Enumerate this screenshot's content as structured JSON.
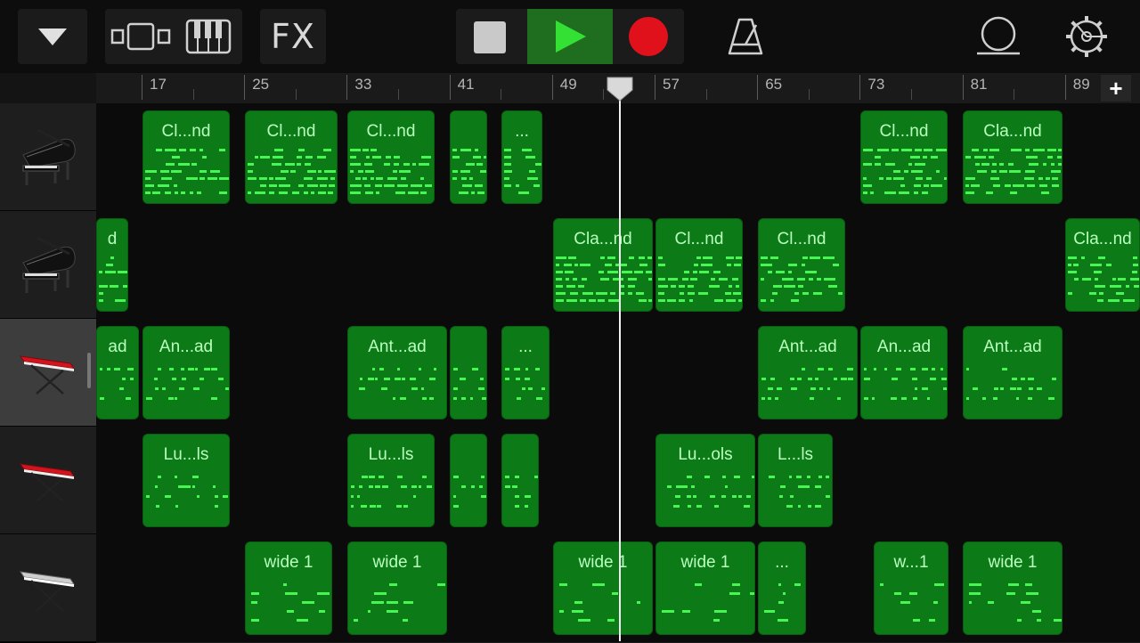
{
  "toolbar": {
    "fx_label": "FX",
    "icons": [
      "dropdown-triangle-icon",
      "view-toggle-icon",
      "keyboard-icon",
      "stop-icon",
      "play-icon",
      "record-icon",
      "metronome-icon",
      "loop-icon",
      "settings-gear-icon"
    ],
    "play_color": "#1f6e1f",
    "record_color": "#e0111a"
  },
  "ruler": {
    "bars": [
      "17",
      "25",
      "33",
      "41",
      "49",
      "57",
      "65",
      "73",
      "81",
      "89"
    ],
    "add_label": "+"
  },
  "tracks": [
    {
      "instrument": "grand-piano",
      "selected": false,
      "regions": [
        {
          "label": "Cl...nd"
        },
        {
          "label": "Cl...nd"
        },
        {
          "label": "Cl...nd"
        },
        {
          "label": ""
        },
        {
          "label": "..."
        },
        {
          "label": "Cl...nd"
        },
        {
          "label": "Cla...nd"
        }
      ]
    },
    {
      "instrument": "grand-piano",
      "selected": false,
      "regions": [
        {
          "label": "d"
        },
        {
          "label": "Cla...nd"
        },
        {
          "label": "Cl...nd"
        },
        {
          "label": "Cl...nd"
        },
        {
          "label": "Cla...nd"
        }
      ]
    },
    {
      "instrument": "red-keyboard",
      "selected": true,
      "regions": [
        {
          "label": "ad"
        },
        {
          "label": "An...ad"
        },
        {
          "label": "Ant...ad"
        },
        {
          "label": ""
        },
        {
          "label": "..."
        },
        {
          "label": "Ant...ad"
        },
        {
          "label": "An...ad"
        },
        {
          "label": "Ant...ad"
        }
      ]
    },
    {
      "instrument": "red-keyboard",
      "selected": false,
      "regions": [
        {
          "label": "Lu...ls"
        },
        {
          "label": "Lu...ls"
        },
        {
          "label": ""
        },
        {
          "label": ""
        },
        {
          "label": "Lu...ols"
        },
        {
          "label": "L...ls"
        }
      ]
    },
    {
      "instrument": "synth-keyboard",
      "selected": false,
      "regions": [
        {
          "label": "wide 1"
        },
        {
          "label": "wide 1"
        },
        {
          "label": "wide 1"
        },
        {
          "label": "wide 1"
        },
        {
          "label": "..."
        },
        {
          "label": "w...1"
        },
        {
          "label": "wide 1"
        }
      ]
    }
  ],
  "colors": {
    "region": "#0b7a17",
    "note": "#47f553"
  }
}
